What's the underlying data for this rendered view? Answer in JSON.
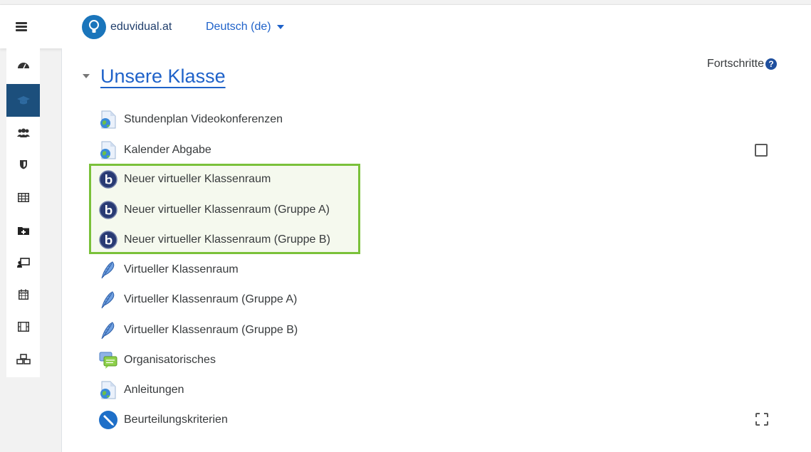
{
  "navbar": {
    "brand": "eduvidual.at",
    "language": "Deutsch (de)"
  },
  "drawer": {
    "items": [
      {
        "icon": "dashboard-icon"
      },
      {
        "icon": "graduation-cap-icon",
        "active": true
      },
      {
        "icon": "users-icon"
      },
      {
        "icon": "shield-icon"
      },
      {
        "icon": "table-icon"
      },
      {
        "icon": "folder-plus-icon"
      },
      {
        "icon": "presentation-icon"
      },
      {
        "icon": "calendar-icon"
      },
      {
        "icon": "film-icon"
      },
      {
        "icon": "cubes-icon"
      }
    ]
  },
  "section": {
    "title": "Unsere Klasse",
    "progress_label": "Fortschritte",
    "help_glyph": "?"
  },
  "activities": [
    {
      "label": "Stundenplan Videokonferenzen",
      "icon": "url-globe-icon",
      "completion": "none"
    },
    {
      "label": "Kalender Abgabe",
      "icon": "url-globe-icon",
      "completion": "manual"
    },
    {
      "label": "Neuer virtueller Klassenraum",
      "icon": "bigbluebutton-icon",
      "completion": "none",
      "highlighted": true
    },
    {
      "label": "Neuer virtueller Klassenraum (Gruppe A)",
      "icon": "bigbluebutton-icon",
      "completion": "none",
      "highlighted": true
    },
    {
      "label": "Neuer virtueller Klassenraum (Gruppe B)",
      "icon": "bigbluebutton-icon",
      "completion": "none",
      "highlighted": true
    },
    {
      "label": "Virtueller Klassenraum",
      "icon": "feather-icon",
      "completion": "none"
    },
    {
      "label": "Virtueller Klassenraum (Gruppe A)",
      "icon": "feather-icon",
      "completion": "none"
    },
    {
      "label": "Virtueller Klassenraum (Gruppe B)",
      "icon": "feather-icon",
      "completion": "none"
    },
    {
      "label": "Organisatorisches",
      "icon": "forum-icon",
      "completion": "none"
    },
    {
      "label": "Anleitungen",
      "icon": "url-globe-icon",
      "completion": "none"
    },
    {
      "label": "Beurteilungskriterien",
      "icon": "assignment-pen-icon",
      "completion": "automatic"
    }
  ],
  "colors": {
    "accent": "#1f62c9",
    "highlight_border": "#7ac13a",
    "drawer_active": "#1c4f7c"
  }
}
